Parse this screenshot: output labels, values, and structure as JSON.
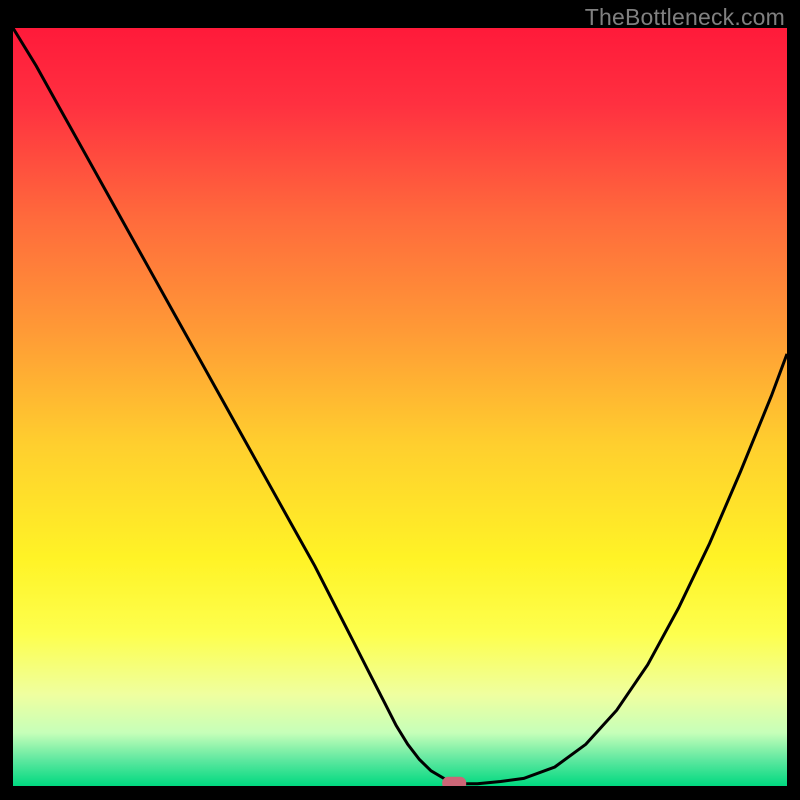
{
  "watermark": "TheBottleneck.com",
  "chart_data": {
    "type": "line",
    "title": "",
    "xlabel": "",
    "ylabel": "",
    "xlim": [
      0,
      100
    ],
    "ylim": [
      0,
      100
    ],
    "grid": false,
    "legend": false,
    "background_gradient": {
      "stops": [
        {
          "offset": 0.0,
          "color": "#ff1a3a"
        },
        {
          "offset": 0.1,
          "color": "#ff3040"
        },
        {
          "offset": 0.25,
          "color": "#ff6a3c"
        },
        {
          "offset": 0.4,
          "color": "#ff9a36"
        },
        {
          "offset": 0.55,
          "color": "#ffcf2e"
        },
        {
          "offset": 0.7,
          "color": "#fff326"
        },
        {
          "offset": 0.8,
          "color": "#fdff4e"
        },
        {
          "offset": 0.88,
          "color": "#efffa0"
        },
        {
          "offset": 0.93,
          "color": "#c6ffb9"
        },
        {
          "offset": 0.965,
          "color": "#60e8a0"
        },
        {
          "offset": 1.0,
          "color": "#00d980"
        }
      ]
    },
    "series": [
      {
        "name": "bottleneck-curve",
        "color": "#000000",
        "x": [
          0,
          3,
          6,
          9,
          12,
          15,
          18,
          21,
          24,
          27,
          30,
          33,
          36,
          39,
          42,
          44,
          46,
          48,
          49.5,
          51,
          52.5,
          54,
          56,
          58,
          60,
          63,
          66,
          70,
          74,
          78,
          82,
          86,
          90,
          94,
          98,
          100
        ],
        "y": [
          100,
          95,
          89.5,
          84,
          78.5,
          73,
          67.5,
          62,
          56.5,
          51,
          45.5,
          40,
          34.5,
          29,
          23,
          19,
          15,
          11,
          8,
          5.5,
          3.5,
          2,
          0.8,
          0.3,
          0.3,
          0.6,
          1,
          2.5,
          5.5,
          10,
          16,
          23.5,
          32,
          41.5,
          51.5,
          57
        ]
      }
    ],
    "marker": {
      "name": "minimum-marker",
      "x": 57,
      "y": 0.3,
      "color": "#cc6677",
      "shape": "rounded-rect"
    }
  }
}
